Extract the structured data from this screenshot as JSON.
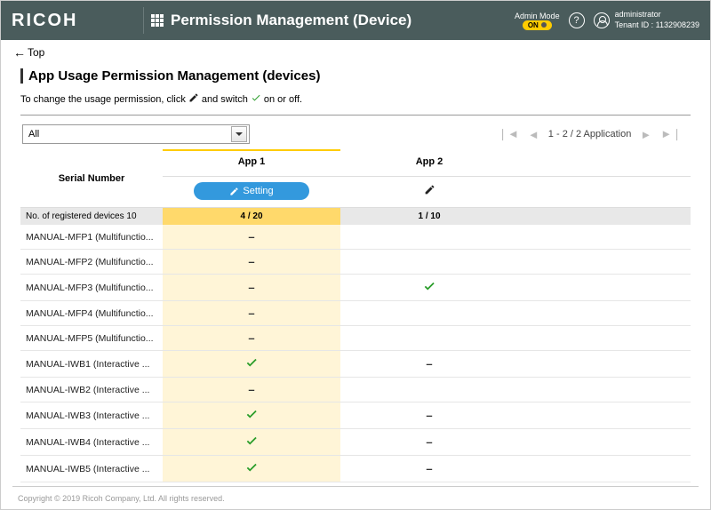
{
  "header": {
    "brand": "RICOH",
    "title": "Permission Management (Device)",
    "admin_mode_label": "Admin Mode",
    "admin_mode_state": "ON",
    "user_name": "administrator",
    "tenant_label": "Tenant ID : 1132908239"
  },
  "topbar": {
    "back_label": "Top"
  },
  "section": {
    "title": "App Usage Permission Management (devices)",
    "instruction_pre": "To change the usage permission, click",
    "instruction_mid": "and switch",
    "instruction_post": "on or off."
  },
  "filter": {
    "selected": "All"
  },
  "pagination": {
    "text": "1 - 2 / 2 Application"
  },
  "columns": {
    "serial_header": "Serial Number",
    "registered_label": "No. of registered devices 10",
    "apps": [
      {
        "name": "App 1",
        "setting_label": "Setting",
        "count": "4 / 20",
        "highlighted": true
      },
      {
        "name": "App 2",
        "setting_label": "",
        "count": "1 / 10",
        "highlighted": false
      }
    ]
  },
  "rows": [
    {
      "serial": "MANUAL-MFP1 (Multifunctio...",
      "app1": "dash",
      "app2": ""
    },
    {
      "serial": "MANUAL-MFP2 (Multifunctio...",
      "app1": "dash",
      "app2": ""
    },
    {
      "serial": "MANUAL-MFP3 (Multifunctio...",
      "app1": "dash",
      "app2": "check"
    },
    {
      "serial": "MANUAL-MFP4 (Multifunctio...",
      "app1": "dash",
      "app2": ""
    },
    {
      "serial": "MANUAL-MFP5 (Multifunctio...",
      "app1": "dash",
      "app2": ""
    },
    {
      "serial": "MANUAL-IWB1 (Interactive ...",
      "app1": "check",
      "app2": "dash"
    },
    {
      "serial": "MANUAL-IWB2 (Interactive ...",
      "app1": "dash",
      "app2": ""
    },
    {
      "serial": "MANUAL-IWB3 (Interactive ...",
      "app1": "check",
      "app2": "dash"
    },
    {
      "serial": "MANUAL-IWB4 (Interactive ...",
      "app1": "check",
      "app2": "dash"
    },
    {
      "serial": "MANUAL-IWB5 (Interactive ...",
      "app1": "check",
      "app2": "dash"
    }
  ],
  "footer": {
    "copyright": "Copyright © 2019 Ricoh Company, Ltd. All rights reserved."
  }
}
